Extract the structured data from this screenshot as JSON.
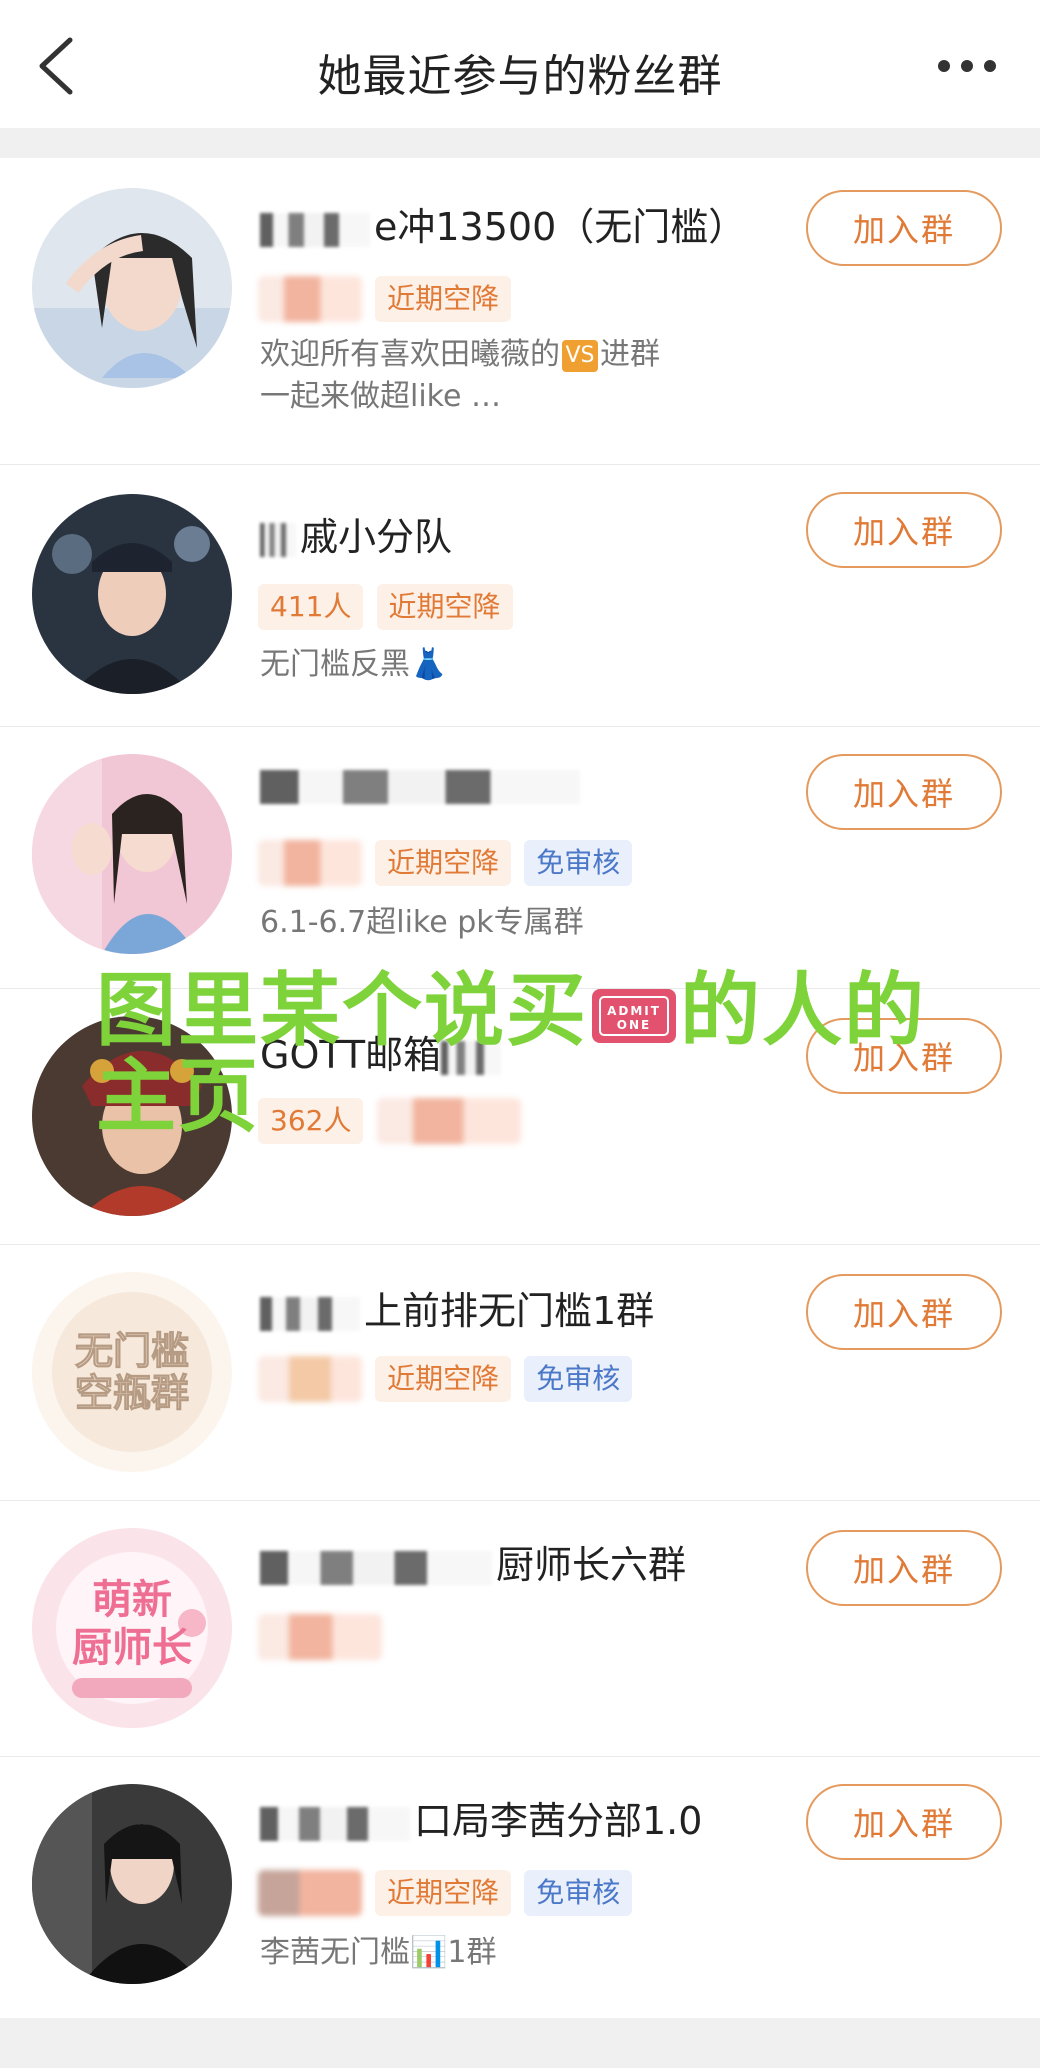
{
  "header": {
    "title": "她最近参与的粉丝群",
    "back_icon": "chevron-left-icon",
    "more_icon": "more-dots-icon"
  },
  "groups": [
    {
      "name": "e冲13500（无门槛）",
      "tags": [
        "近期空降"
      ],
      "desc_lines": [
        "欢迎所有喜欢田曦薇的",
        "进群",
        "一起来做超like …"
      ],
      "join_label": "加入群"
    },
    {
      "name": "戚小分队",
      "tags": [
        "411人",
        "近期空降"
      ],
      "desc_lines": [
        "无门槛反黑👗"
      ],
      "join_label": "加入群"
    },
    {
      "name": "",
      "tags": [
        "近期空降",
        "免审核"
      ],
      "desc_lines": [
        "6.1-6.7超like pk专属群"
      ],
      "join_label": "加入群"
    },
    {
      "name": "GOTT邮箱",
      "tags": [
        "362人"
      ],
      "desc_lines": [],
      "join_label": "加入群"
    },
    {
      "name": "上前排无门槛1群",
      "tags": [
        "近期空降",
        "免审核"
      ],
      "desc_lines": [],
      "avatar_text": [
        "无门槛",
        "空瓶群"
      ],
      "join_label": "加入群"
    },
    {
      "name": "厨师长六群",
      "tags": [],
      "desc_lines": [],
      "avatar_text": [
        "萌新",
        "厨师长"
      ],
      "join_label": "加入群"
    },
    {
      "name": "口局李茜分部1.0",
      "tags": [
        "近期空降",
        "免审核"
      ],
      "desc_lines": [
        "李茜无门槛📊1群"
      ],
      "join_label": "加入群"
    }
  ],
  "overlay": {
    "text_before": "图里某个说买",
    "text_after": "的人的主页",
    "color": "#7fd33a",
    "icon": "admit-one-ticket-icon",
    "ticket_text": [
      "ADMIT",
      "ONE"
    ]
  },
  "colors": {
    "accent_orange": "#e07a36",
    "tag_blue": "#4b78c8"
  }
}
